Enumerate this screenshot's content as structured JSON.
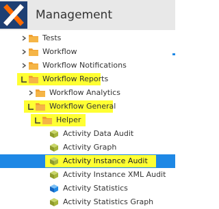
{
  "header": {
    "title": "Management"
  },
  "colors": {
    "highlight": "#ffff33",
    "selected": "#1e88e5",
    "folder": "#f0a030",
    "cube_green": "#a6b53a",
    "cube_blue": "#1e88e5"
  },
  "tree": {
    "items": [
      {
        "label": "Tests",
        "type": "folder",
        "state": "collapsed",
        "highlight": false
      },
      {
        "label": "Workflow",
        "type": "folder",
        "state": "collapsed",
        "highlight": false
      },
      {
        "label": "Workflow Notifications",
        "type": "folder",
        "state": "collapsed",
        "highlight": false
      },
      {
        "label": "Workflow Reports",
        "type": "folder",
        "state": "expanded",
        "highlight": true
      },
      {
        "label": "Workflow Analytics",
        "type": "folder",
        "state": "collapsed",
        "highlight": false
      },
      {
        "label": "Workflow General",
        "type": "folder",
        "state": "expanded",
        "highlight": true
      },
      {
        "label": "Helper",
        "type": "folder",
        "state": "expanded",
        "highlight": true
      },
      {
        "label": "Activity Data Audit",
        "type": "report",
        "icon": "cube-icon-green"
      },
      {
        "label": "Activity Graph",
        "type": "report",
        "icon": "cube-icon-green"
      },
      {
        "label": "Activity Instance Audit",
        "type": "report",
        "icon": "cube-icon-green",
        "selected": true,
        "highlight": true
      },
      {
        "label": "Activity Instance XML Audit",
        "type": "report",
        "icon": "cube-icon-green"
      },
      {
        "label": "Activity Statistics",
        "type": "report",
        "icon": "cube-icon-blue"
      },
      {
        "label": "Activity Statistics Graph",
        "type": "report",
        "icon": "cube-icon-green"
      }
    ]
  }
}
